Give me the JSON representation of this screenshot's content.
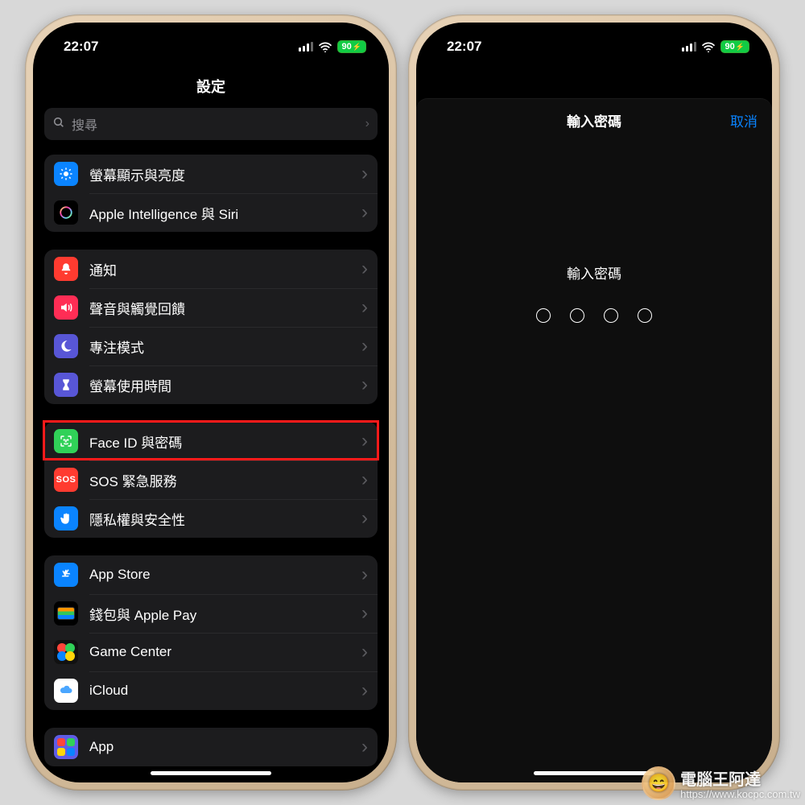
{
  "status": {
    "time": "22:07",
    "battery": "90"
  },
  "phone_left": {
    "title": "設定",
    "search_placeholder": "搜尋",
    "groups": [
      [
        {
          "id": "display",
          "label": "螢幕顯示與亮度",
          "icon": "sun-icon",
          "bg": "#0a84ff"
        },
        {
          "id": "siri",
          "label": "Apple Intelligence 與 Siri",
          "icon": "sparkle-icon",
          "bg": "#000000"
        }
      ],
      [
        {
          "id": "notifications",
          "label": "通知",
          "icon": "bell-icon",
          "bg": "#ff3b30"
        },
        {
          "id": "sounds",
          "label": "聲音與觸覺回饋",
          "icon": "speaker-icon",
          "bg": "#ff2d55"
        },
        {
          "id": "focus",
          "label": "專注模式",
          "icon": "moon-icon",
          "bg": "#5856d6"
        },
        {
          "id": "screentime",
          "label": "螢幕使用時間",
          "icon": "hourglass-icon",
          "bg": "#5856d6"
        }
      ],
      [
        {
          "id": "faceid",
          "label": "Face ID 與密碼",
          "icon": "faceid-icon",
          "bg": "#30d158",
          "highlight": true
        },
        {
          "id": "sos",
          "label": "SOS 緊急服務",
          "icon": "sos-icon",
          "bg": "#ff3b30"
        },
        {
          "id": "privacy",
          "label": "隱私權與安全性",
          "icon": "hand-icon",
          "bg": "#0a84ff"
        }
      ],
      [
        {
          "id": "appstore",
          "label": "App Store",
          "icon": "appstore-icon",
          "bg": "#0a84ff"
        },
        {
          "id": "wallet",
          "label": "錢包與 Apple Pay",
          "icon": "wallet-icon",
          "bg": "#000000"
        },
        {
          "id": "gamecenter",
          "label": "Game Center",
          "icon": "gamecenter-icon",
          "bg": "#111111"
        },
        {
          "id": "icloud",
          "label": "iCloud",
          "icon": "icloud-icon",
          "bg": "#ffffff"
        }
      ],
      [
        {
          "id": "app",
          "label": "App",
          "icon": "apps-icon",
          "bg": "#5e5ce6"
        }
      ]
    ]
  },
  "phone_right": {
    "nav_title": "輸入密碼",
    "cancel": "取消",
    "prompt": "輸入密碼",
    "dot_count": 4
  },
  "watermark": {
    "brand": "電腦王阿達",
    "url": "https://www.kocpc.com.tw"
  }
}
